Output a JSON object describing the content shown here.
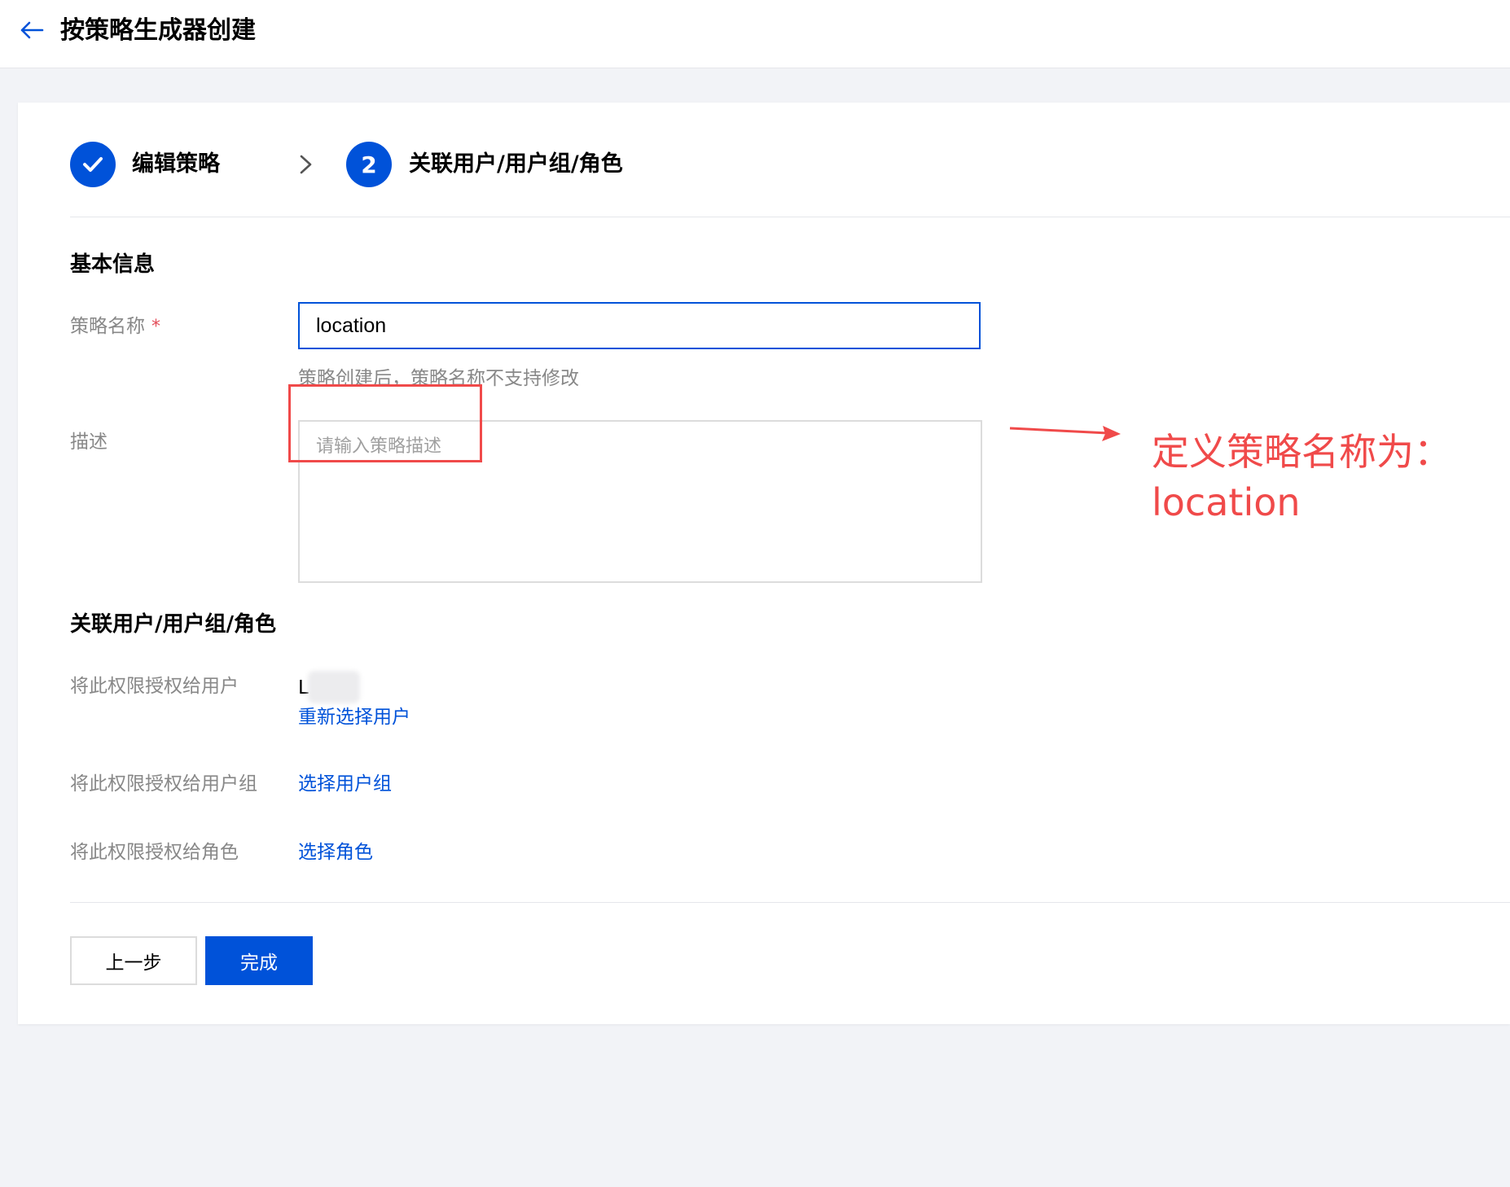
{
  "header": {
    "title": "按策略生成器创建"
  },
  "steps": [
    {
      "label": "编辑策略",
      "status": "done"
    },
    {
      "number": "2",
      "label": "关联用户/用户组/角色",
      "status": "current"
    }
  ],
  "basic_info": {
    "section_title": "基本信息",
    "policy_name_label": "策略名称",
    "required_mark": "*",
    "policy_name_value": "location",
    "policy_name_help": "策略创建后，策略名称不支持修改",
    "description_label": "描述",
    "description_placeholder": "请输入策略描述"
  },
  "association": {
    "section_title": "关联用户/用户组/角色",
    "users_label": "将此权限授权给用户",
    "users_value": "L",
    "users_link": "重新选择用户",
    "groups_label": "将此权限授权给用户组",
    "groups_link": "选择用户组",
    "roles_label": "将此权限授权给角色",
    "roles_link": "选择角色"
  },
  "footer": {
    "prev_label": "上一步",
    "finish_label": "完成"
  },
  "annotation": {
    "text": "定义策略名称为：\nlocation",
    "color": "#f04a4a"
  },
  "colors": {
    "primary": "#0052d9",
    "required": "#e34d59",
    "muted_text": "#888888"
  }
}
